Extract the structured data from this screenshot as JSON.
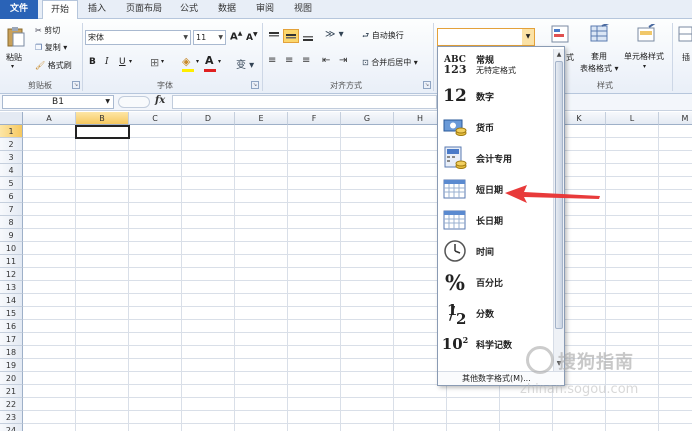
{
  "tabs": [
    "文件",
    "开始",
    "插入",
    "页面布局",
    "公式",
    "数据",
    "审阅",
    "视图"
  ],
  "clipboard": {
    "paste": "粘贴",
    "cut": "剪切",
    "copy": "复制",
    "format_painter": "格式刷",
    "label": "剪贴板"
  },
  "font": {
    "name": "宋体",
    "size": "11",
    "label": "字体",
    "bold": "B",
    "italic": "I",
    "underline": "U",
    "grow": "A",
    "shrink": "A",
    "font_color": "A",
    "phonetic": "变"
  },
  "alignment": {
    "wrap": "自动换行",
    "merge": "合并后居中",
    "label": "对齐方式"
  },
  "styles": {
    "conditional": "式",
    "table_format_1": "套用",
    "table_format_2": "表格格式",
    "cell_styles": "单元格样式",
    "label": "样式",
    "insert": "插"
  },
  "formula_bar": {
    "name_box": "B1",
    "fx": "fx"
  },
  "grid": {
    "columns": [
      "A",
      "B",
      "C",
      "D",
      "E",
      "F",
      "G",
      "H",
      "I",
      "J",
      "K",
      "L",
      "M"
    ],
    "rows": [
      "1",
      "2",
      "3",
      "4",
      "5",
      "6",
      "7",
      "8",
      "9",
      "10",
      "11",
      "12",
      "13",
      "14",
      "15",
      "16",
      "17",
      "18",
      "19",
      "20",
      "21",
      "22",
      "23",
      "24"
    ],
    "selected_col": "B",
    "selected_row": "1"
  },
  "number_format_menu": {
    "items": [
      {
        "label": "常规",
        "sub": "无特定格式",
        "icon": "general-icon",
        "glyph_top": "ABC",
        "glyph_bottom": "123"
      },
      {
        "label": "数字",
        "sub": "",
        "icon": "number-icon",
        "glyph": "12"
      },
      {
        "label": "货币",
        "sub": "",
        "icon": "currency-icon"
      },
      {
        "label": "会计专用",
        "sub": "",
        "icon": "accounting-icon"
      },
      {
        "label": "短日期",
        "sub": "",
        "icon": "short-date-icon"
      },
      {
        "label": "长日期",
        "sub": "",
        "icon": "long-date-icon"
      },
      {
        "label": "时间",
        "sub": "",
        "icon": "clock-icon"
      },
      {
        "label": "百分比",
        "sub": "",
        "icon": "percent-icon",
        "glyph": "%"
      },
      {
        "label": "分数",
        "sub": "",
        "icon": "fraction-icon",
        "glyph_top": "1",
        "glyph_bottom": "2"
      },
      {
        "label": "科学记数",
        "sub": "",
        "icon": "scientific-icon",
        "glyph": "10",
        "exp": "2"
      }
    ],
    "more": "其他数字格式(M)..."
  },
  "watermark": {
    "text": "搜狗指南",
    "url": "zhinan.sogou.com"
  },
  "colors": {
    "accent": "#2a63b7",
    "selection": "#f6c85f",
    "arrow": "#e83a3a"
  }
}
